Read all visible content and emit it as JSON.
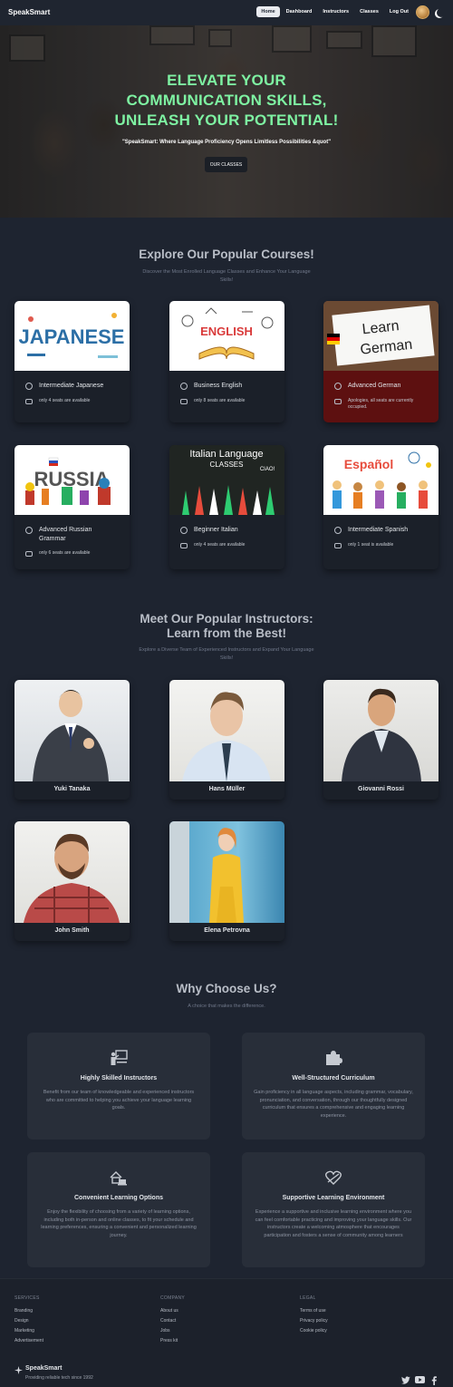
{
  "nav": {
    "brand": "SpeakSmart",
    "links": [
      "Home",
      "Dashboard",
      "Instructors",
      "Classes",
      "Log Out"
    ]
  },
  "hero": {
    "title_line1": "ELEVATE YOUR",
    "title_line2": "COMMUNICATION SKILLS,",
    "title_line3": "UNLEASH YOUR POTENTIAL!",
    "subtitle": "\"SpeakSmart: Where Language Proficiency Opens Limitless Possibilities &quot\"",
    "button": "OUR CLASSES"
  },
  "courses": {
    "title": "Explore Our Popular Courses!",
    "subtitle": "Discover the Most Enrolled Language Classes and Enhance Your Language Skills!",
    "items": [
      {
        "name": "Intermediate Japanese",
        "seats": "only 4 seats are available",
        "banner": "JAPANESE"
      },
      {
        "name": "Business English",
        "seats": "only 8 seats are available",
        "banner": "ENGLISH"
      },
      {
        "name": "Advanced German",
        "seats": "Apologies, all seats are currently occupied.",
        "banner_line1": "Learn",
        "banner_line2": "German"
      },
      {
        "name": "Advanced Russian Grammar",
        "seats": "only 6 seats are available",
        "banner": "RUSSIA"
      },
      {
        "name": "Beginner Italian",
        "seats": "only 4 seats are available",
        "banner_line1": "Italian Language",
        "banner_line2": "CLASSES",
        "banner_extra": "CIAO!"
      },
      {
        "name": "Intermediate Spanish",
        "seats": "only 1 seat is available",
        "banner": "Español"
      }
    ]
  },
  "instructors": {
    "title_line1": "Meet Our Popular Instructors:",
    "title_line2": "Learn from the Best!",
    "subtitle": "Explore a Diverse Team of Experienced Instructors and Expand Your Language Skills!",
    "items": [
      "Yuki Tanaka",
      "Hans Müller",
      "Giovanni Rossi",
      "John Smith",
      "Elena Petrovna"
    ]
  },
  "why": {
    "title": "Why Choose Us?",
    "subtitle": "A choice that makes the difference.",
    "items": [
      {
        "title": "Highly Skilled Instructors",
        "desc": "Benefit from our team of knowledgeable and experienced instructors who are committed to helping you achieve your language learning goals.",
        "icon": "teacher-icon"
      },
      {
        "title": "Well-Structured Curriculum",
        "desc": "Gain proficiency in all language aspects, including grammar, vocabulary, pronunciation, and conversation, through our thoughtfully designed curriculum that ensures a comprehensive and engaging learning experience.",
        "icon": "puzzle-icon"
      },
      {
        "title": "Convenient Learning Options",
        "desc": "Enjoy the flexibility of choosing from a variety of learning options, including both in-person and online classes, to fit your schedule and learning preferences, ensuring a convenient and personalized learning journey.",
        "icon": "home-laptop-icon"
      },
      {
        "title": "Supportive Learning Environment",
        "desc": "Experience a supportive and inclusive learning environment where you can feel comfortable practicing and improving your language skills. Our instructors create a welcoming atmosphere that encourages participation and fosters a sense of community among learners",
        "icon": "heart-hands-icon"
      }
    ]
  },
  "footer": {
    "services": {
      "heading": "SERVICES",
      "links": [
        "Branding",
        "Design",
        "Marketing",
        "Advertisement"
      ]
    },
    "company": {
      "heading": "COMPANY",
      "links": [
        "About us",
        "Contact",
        "Jobs",
        "Press kit"
      ]
    },
    "legal": {
      "heading": "LEGAL",
      "links": [
        "Terms of use",
        "Privacy policy",
        "Cookie policy"
      ]
    },
    "brand": "SpeakSmart",
    "tagline": "Providing reliable tech since 1992",
    "social": [
      "twitter-icon",
      "youtube-icon",
      "facebook-icon"
    ]
  },
  "colors": {
    "accent": "#7ef2a2",
    "background": "#1e2430",
    "card": "#1b2029",
    "full_card": "#5d1010"
  }
}
